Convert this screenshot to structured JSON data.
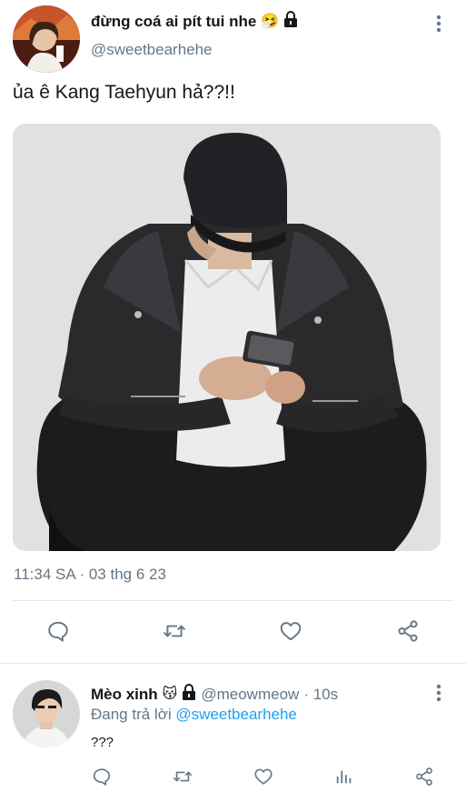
{
  "tweet": {
    "display_name": "đừng coá ai pít tui nhe",
    "name_emoji": "🤧",
    "handle": "@sweetbearhehe",
    "text": "ủa ê Kang Taehyun hả??!!",
    "timestamp": "11:34 SA · 03 thg 6 23",
    "media_description": "photo-person-in-cap-and-leather-jacket"
  },
  "reply": {
    "display_name": "Mèo xinh",
    "name_emoji": "😽",
    "handle": "@meowmeow",
    "time": "· 10s",
    "replying_to_label": "Đang trả lời",
    "replying_to_handle": "@sweetbearhehe",
    "text": "???"
  },
  "icons": {
    "tweet_actions": [
      "reply-icon",
      "retweet-icon",
      "like-icon",
      "share-icon"
    ],
    "reply_actions": [
      "reply-icon",
      "retweet-icon",
      "like-icon",
      "analytics-icon",
      "share-icon"
    ]
  },
  "colors": {
    "text": "#14171a",
    "secondary": "#657786",
    "link": "#1da1f2",
    "divider": "#e1e8ed"
  }
}
